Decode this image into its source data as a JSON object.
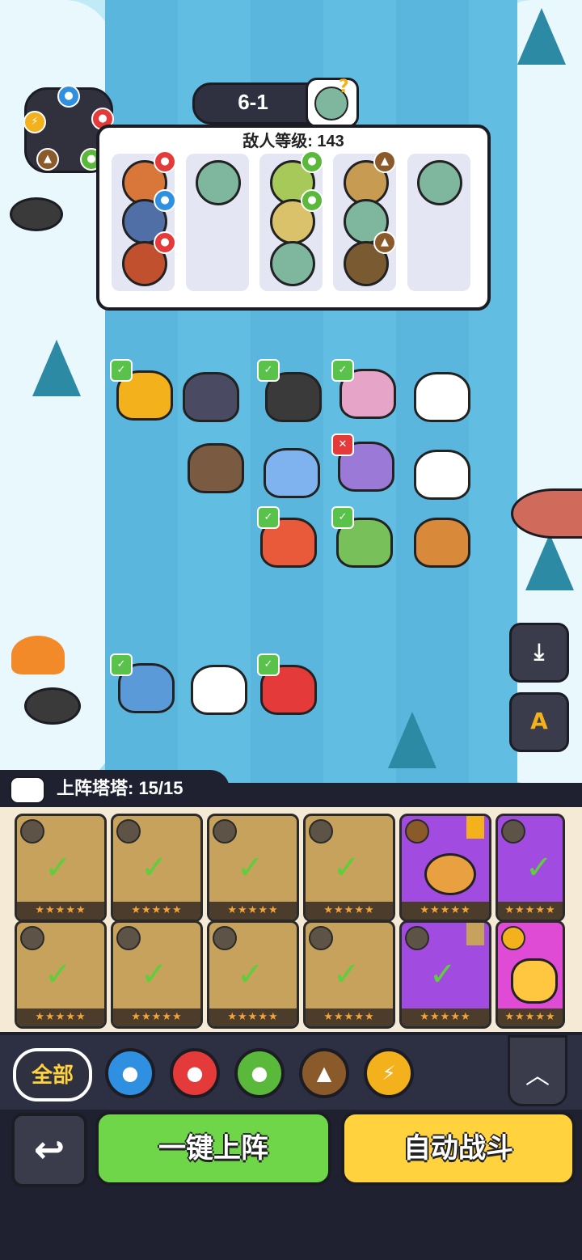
{
  "stage": {
    "label": "6-1"
  },
  "enemy_panel": {
    "title": "敌人等级: 143"
  },
  "element_colors": {
    "water": "#2f8fe0",
    "fire": "#e43a3a",
    "leaf": "#5ab93a",
    "earth": "#8a5a2b",
    "thunder": "#f3b21c"
  },
  "tray": {
    "title": "上阵塔塔: 15/15"
  },
  "filters": {
    "all_label": "全部",
    "icons": [
      "water-icon",
      "fire-icon",
      "leaf-icon",
      "earth-icon",
      "thunder-icon"
    ]
  },
  "buttons": {
    "deploy_all": "一键上阵",
    "auto_battle": "自动战斗",
    "settings_glyph": "A"
  },
  "cards": {
    "stars": "★★★★★"
  }
}
